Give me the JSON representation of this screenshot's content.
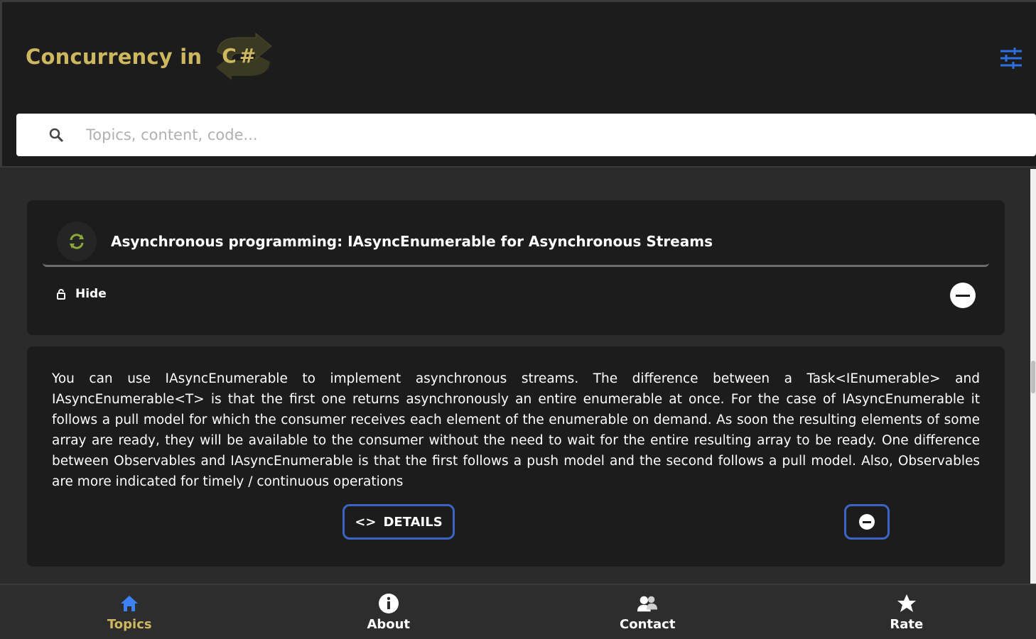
{
  "header": {
    "title": "Concurrency in",
    "logo_text": "C#",
    "settings_icon": "sliders-icon"
  },
  "search": {
    "placeholder": "Topics, content, code...",
    "value": ""
  },
  "topic": {
    "title": "Asynchronous programming: IAsyncEnumerable for Asynchronous Streams",
    "avatar_icon": "sync-icon",
    "hide_label": "Hide"
  },
  "detail": {
    "text": "You can use IAsyncEnumerable to implement asynchronous streams. The difference between a Task<IEnumerable> and IAsyncEnumerable<T> is that the first one returns asynchronously an entire enumerable at once. For the case of IAsyncEnumerable it follows a pull model for which the consumer receives each element of the enumerable on demand. As soon the resulting elements of some array are ready, they will be available to the consumer without the need to wait for the entire resulting array to be ready. One difference between Observables and IAsyncEnumerable is that the first follows a push model and the second follows a pull model. Also, Observables are more indicated for timely / continuous operations",
    "details_button": "DETAILS",
    "details_icon": "<>"
  },
  "nav": {
    "items": [
      {
        "label": "Topics",
        "icon": "home-icon",
        "active": true
      },
      {
        "label": "About",
        "icon": "info-icon",
        "active": false
      },
      {
        "label": "Contact",
        "icon": "contact-icon",
        "active": false
      },
      {
        "label": "Rate",
        "icon": "star-icon",
        "active": false
      }
    ]
  },
  "colors": {
    "accent_gold": "#cdb860",
    "button_border_blue": "#3b64c4",
    "settings_blue": "#2f6fe0",
    "home_blue": "#3b82f6"
  }
}
